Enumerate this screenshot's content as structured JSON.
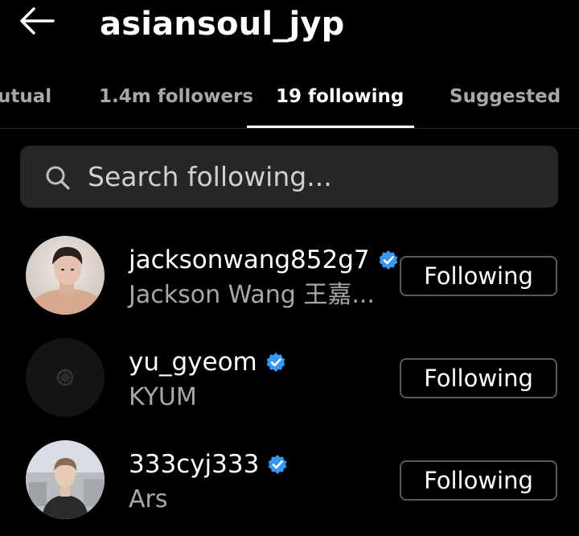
{
  "header": {
    "title": "asiansoul_jyp"
  },
  "tabs": [
    {
      "label": "utual",
      "active": false
    },
    {
      "label": "1.4m followers",
      "active": false
    },
    {
      "label": "19 following",
      "active": true
    },
    {
      "label": "Suggested",
      "active": false
    }
  ],
  "search": {
    "placeholder": "Search following..."
  },
  "accounts": [
    {
      "username": "jacksonwang852g7",
      "full_name": "Jackson Wang 王嘉...",
      "verified": true,
      "button": "Following"
    },
    {
      "username": "yu_gyeom",
      "full_name": "KYUM",
      "verified": true,
      "button": "Following"
    },
    {
      "username": "333cyj333",
      "full_name": "Ars",
      "verified": true,
      "button": "Following"
    }
  ],
  "colors": {
    "background": "#000000",
    "secondary_text": "#a8a8a8",
    "search_bg": "#262626",
    "verified_blue": "#3897f0",
    "button_border": "#5a5a5a"
  }
}
